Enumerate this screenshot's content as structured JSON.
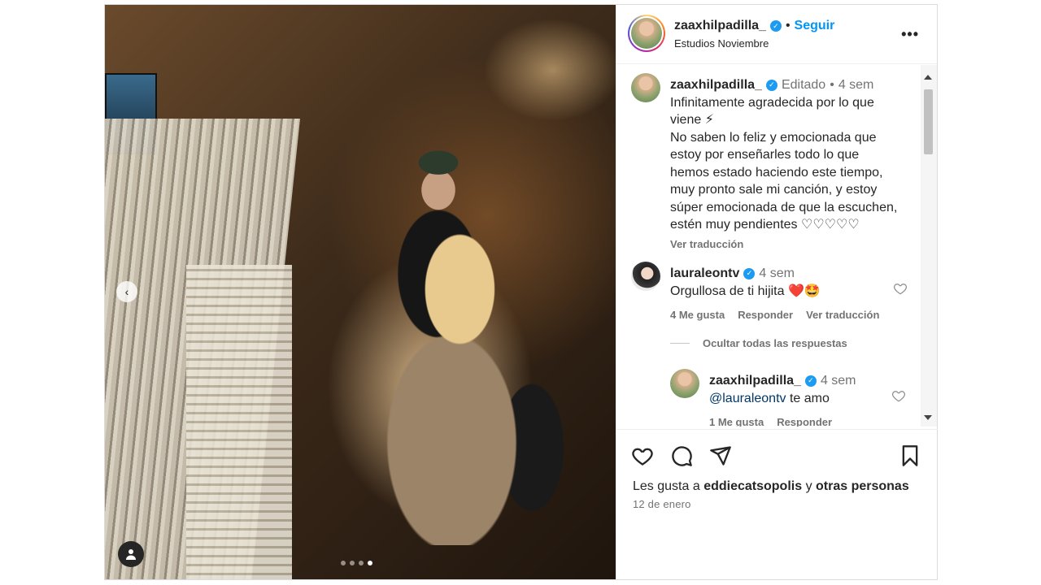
{
  "header": {
    "username": "zaaxhilpadilla_",
    "follow_label": "Seguir",
    "location": "Estudios Noviembre",
    "more_label": "•••"
  },
  "caption": {
    "username": "zaaxhilpadilla_",
    "edited_label": "Editado",
    "time": "4 sem",
    "text": "Infinitamente agradecida por lo que viene ⚡\nNo saben lo feliz y emocionada que estoy por enseñarles todo lo que hemos estado haciendo este tiempo, muy pronto sale mi canción, y estoy súper emocionada de que la escuchen, estén muy pendientes ♡♡♡♡♡",
    "translate_label": "Ver traducción"
  },
  "comments": [
    {
      "username": "lauraleontv",
      "time": "4 sem",
      "text": "Orgullosa de ti hijita ❤️🤩",
      "likes": "4 Me gusta",
      "reply_label": "Responder",
      "translate_label": "Ver traducción"
    }
  ],
  "hide_replies_label": "Ocultar todas las respuestas",
  "reply": {
    "username": "zaaxhilpadilla_",
    "time": "4 sem",
    "mention": "@lauraleontv",
    "text": "te amo",
    "likes": "1 Me gusta",
    "reply_label": "Responder"
  },
  "footer": {
    "likes_prefix": "Les gusta a",
    "likes_user": "eddiecatsopolis",
    "likes_join": "y",
    "likes_others": "otras personas",
    "date": "12 de enero"
  },
  "carousel": {
    "count": 4,
    "active_index": 3
  },
  "colors": {
    "accent": "#0095f6",
    "verified": "#1d9bf0",
    "muted": "#737373"
  },
  "icons": [
    "heart-icon",
    "comment-icon",
    "share-icon",
    "bookmark-icon",
    "more-icon",
    "tag-user-icon",
    "chevron-left-icon"
  ]
}
